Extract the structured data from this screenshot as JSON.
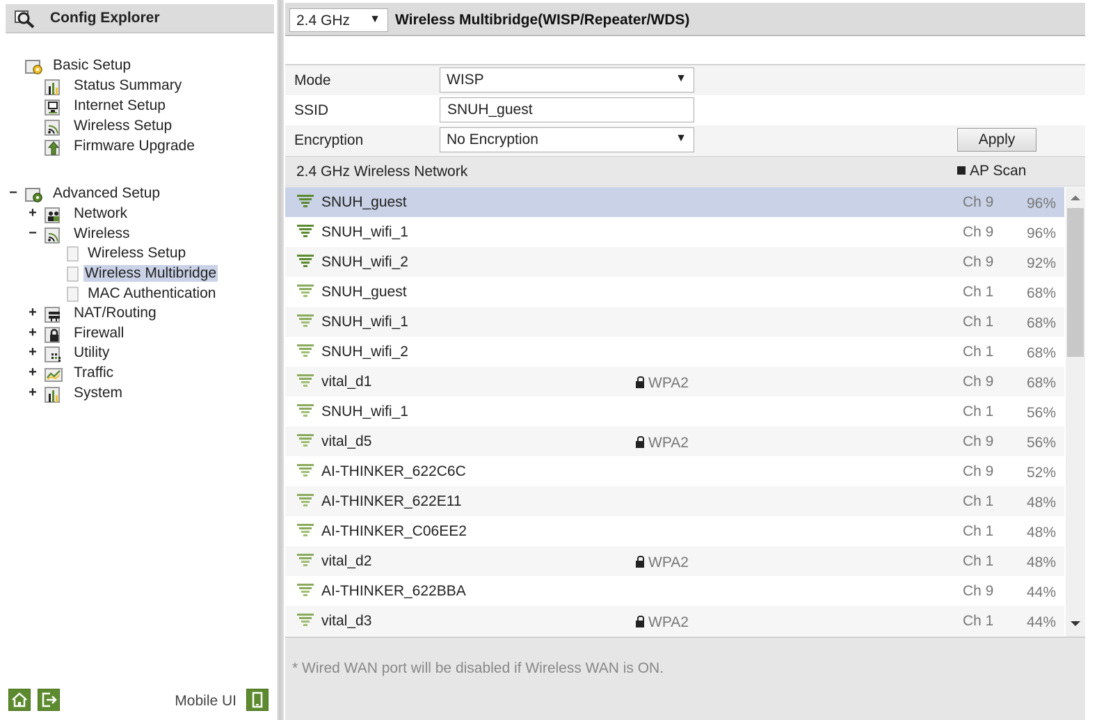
{
  "explorer": {
    "title": "Config Explorer",
    "basic": {
      "label": "Basic Setup",
      "items": [
        "Status Summary",
        "Internet Setup",
        "Wireless Setup",
        "Firmware Upgrade"
      ]
    },
    "advanced": {
      "toggle": "−",
      "label": "Advanced Setup",
      "network": {
        "toggle": "+",
        "label": "Network"
      },
      "wireless": {
        "toggle": "−",
        "label": "Wireless",
        "children": [
          "Wireless Setup",
          "Wireless Multibridge",
          "MAC Authentication"
        ],
        "selected": "Wireless Multibridge"
      },
      "others": [
        {
          "toggle": "+",
          "label": "NAT/Routing",
          "icon": "nat-icon"
        },
        {
          "toggle": "+",
          "label": "Firewall",
          "icon": "firewall-lock-icon"
        },
        {
          "toggle": "+",
          "label": "Utility",
          "icon": "utility-icon"
        },
        {
          "toggle": "+",
          "label": "Traffic",
          "icon": "traffic-chart-icon"
        },
        {
          "toggle": "+",
          "label": "System",
          "icon": "system-chart-icon"
        }
      ]
    },
    "mobile_label": "Mobile UI"
  },
  "header": {
    "band": "2.4 GHz",
    "title": "Wireless Multibridge(WISP/Repeater/WDS)"
  },
  "form": {
    "mode_label": "Mode",
    "mode_value": "WISP",
    "ssid_label": "SSID",
    "ssid_value": "SNUH_guest",
    "encryption_label": "Encryption",
    "encryption_value": "No Encryption",
    "apply": "Apply"
  },
  "network_list": {
    "title": "2.4 GHz Wireless Network",
    "scan_label": "AP Scan",
    "rows": [
      {
        "ssid": "SNUH_guest",
        "security": "",
        "channel": "Ch 9",
        "signal": "96%",
        "selected": true
      },
      {
        "ssid": "SNUH_wifi_1",
        "security": "",
        "channel": "Ch 9",
        "signal": "96%"
      },
      {
        "ssid": "SNUH_wifi_2",
        "security": "",
        "channel": "Ch 9",
        "signal": "92%"
      },
      {
        "ssid": "SNUH_guest",
        "security": "",
        "channel": "Ch 1",
        "signal": "68%"
      },
      {
        "ssid": "SNUH_wifi_1",
        "security": "",
        "channel": "Ch 1",
        "signal": "68%"
      },
      {
        "ssid": "SNUH_wifi_2",
        "security": "",
        "channel": "Ch 1",
        "signal": "68%"
      },
      {
        "ssid": "vital_d1",
        "security": "WPA2",
        "channel": "Ch 9",
        "signal": "68%"
      },
      {
        "ssid": "SNUH_wifi_1",
        "security": "",
        "channel": "Ch 1",
        "signal": "56%"
      },
      {
        "ssid": "vital_d5",
        "security": "WPA2",
        "channel": "Ch 9",
        "signal": "56%"
      },
      {
        "ssid": "AI-THINKER_622C6C",
        "security": "",
        "channel": "Ch 9",
        "signal": "52%"
      },
      {
        "ssid": "AI-THINKER_622E11",
        "security": "",
        "channel": "Ch 1",
        "signal": "48%"
      },
      {
        "ssid": "AI-THINKER_C06EE2",
        "security": "",
        "channel": "Ch 1",
        "signal": "48%"
      },
      {
        "ssid": "vital_d2",
        "security": "WPA2",
        "channel": "Ch 1",
        "signal": "48%"
      },
      {
        "ssid": "AI-THINKER_622BBA",
        "security": "",
        "channel": "Ch 9",
        "signal": "44%"
      },
      {
        "ssid": "vital_d3",
        "security": "WPA2",
        "channel": "Ch 1",
        "signal": "44%"
      }
    ]
  },
  "footnote": "* Wired WAN port will be disabled if Wireless WAN is ON.",
  "colors": {
    "accent_green": "#5c8a2e",
    "selected_row": "#c9d2e6",
    "header_gray": "#dcdcdc"
  }
}
